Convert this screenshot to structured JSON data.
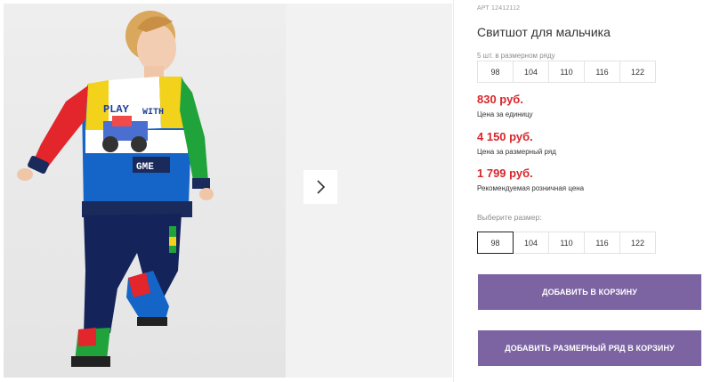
{
  "product": {
    "sku": "АРТ 12412112",
    "title": "Свитшот для мальчика",
    "size_set_note": "5 шт. в размерном ряду",
    "size_set": [
      "98",
      "104",
      "110",
      "116",
      "122"
    ],
    "prices": [
      {
        "value": "830 руб.",
        "label": "Цена за единицу"
      },
      {
        "value": "4 150 руб.",
        "label": "Цена за размерный ряд"
      },
      {
        "value": "1 799 руб.",
        "label": "Рекомендуемая розничная цена"
      }
    ],
    "choose_size_label": "Выберите размер:",
    "sizes": [
      "98",
      "104",
      "110",
      "116",
      "122"
    ],
    "selected_size": "98"
  },
  "actions": {
    "add_to_cart": "ДОБАВИТЬ В КОРЗИНУ",
    "add_set_to_cart": "ДОБАВИТЬ РАЗМЕРНЫЙ РЯД В КОРЗИНУ"
  },
  "gallery": {
    "next_icon": "chevron-right-icon",
    "sweatshirt_print": [
      "PLAY",
      "WITH",
      "GME"
    ]
  },
  "colors": {
    "price": "#d8262b",
    "button": "#7c63a2",
    "border": "#e3e3e3"
  }
}
